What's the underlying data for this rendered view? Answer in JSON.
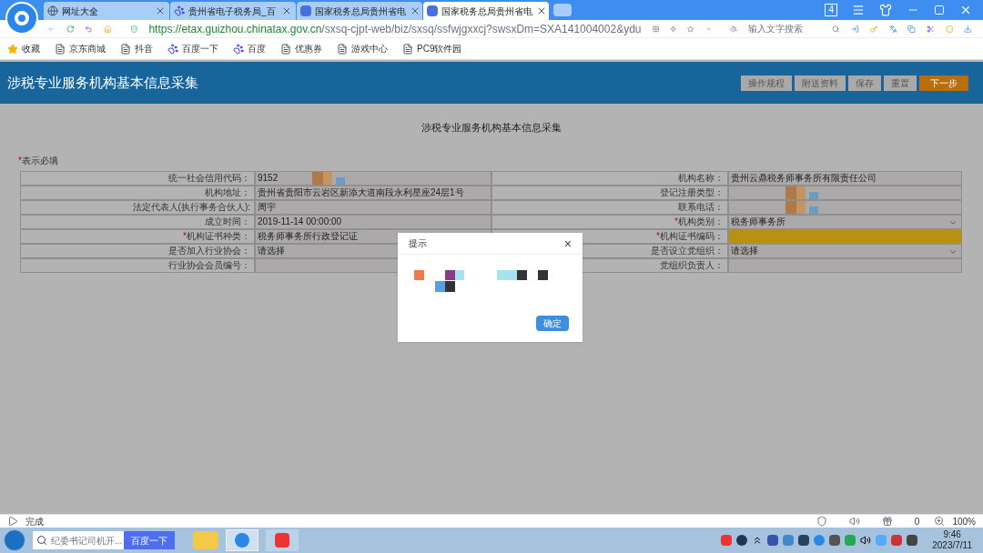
{
  "browser": {
    "tabs": [
      {
        "label": "网址大全",
        "selected": false,
        "kind": "globe"
      },
      {
        "label": "贵州省电子税务局_百",
        "selected": false,
        "kind": "paw"
      },
      {
        "label": "国家税务总局贵州省电",
        "selected": false,
        "kind": "site"
      },
      {
        "label": "国家税务总局贵州省电",
        "selected": true,
        "kind": "site"
      }
    ],
    "tab_count": "4",
    "url_host": "https://etax.guizhou.chinatax.gov.cn",
    "url_path": "/sxsq-cjpt-web/biz/sxsq/ssfwjgxxcj?swsxDm=SXA141004002&ydu",
    "search_placeholder": "输入文字搜索",
    "bookmarks": [
      {
        "label": "收藏",
        "kind": "star"
      },
      {
        "label": "京东商城",
        "kind": "page"
      },
      {
        "label": "抖音",
        "kind": "page"
      },
      {
        "label": "百度一下",
        "kind": "paw"
      },
      {
        "label": "百度",
        "kind": "paw"
      },
      {
        "label": "优惠券",
        "kind": "page"
      },
      {
        "label": "游戏中心",
        "kind": "page"
      },
      {
        "label": "PC9软件园",
        "kind": "page"
      }
    ]
  },
  "header": {
    "title": "涉税专业服务机构基本信息采集",
    "buttons": [
      {
        "label": "操作规程",
        "primary": false
      },
      {
        "label": "附送资料",
        "primary": false
      },
      {
        "label": "保存",
        "primary": false
      },
      {
        "label": "重置",
        "primary": false
      },
      {
        "label": "下一步",
        "primary": true
      }
    ]
  },
  "form": {
    "title": "涉税专业服务机构基本信息采集",
    "required_mark": "*",
    "required_note": "表示必填",
    "rows": [
      {
        "left": {
          "label": "统一社会信用代码：",
          "value": "9152",
          "required": false,
          "redacted": true
        },
        "right": {
          "label": "机构名称：",
          "value": "贵州云鼎税务师事务所有限责任公司",
          "required": false,
          "kind": "text",
          "highlighted": false,
          "redacted": false
        }
      },
      {
        "left": {
          "label": "机构地址：",
          "value": "贵州省贵阳市云岩区新添大道南段永利星座24层1号",
          "required": false,
          "redacted": false
        },
        "right": {
          "label": "登记注册类型：",
          "required": false,
          "kind": "text",
          "highlighted": false,
          "redacted": true
        }
      },
      {
        "left": {
          "label": "法定代表人(执行事务合伙人):",
          "value": "周宇",
          "required": false,
          "redacted": false
        },
        "right": {
          "label": "联系电话：",
          "required": false,
          "kind": "text",
          "highlighted": false,
          "redacted": true
        }
      },
      {
        "left": {
          "label": "成立时间：",
          "value": "2019-11-14 00:00:00",
          "required": false,
          "redacted": false
        },
        "right": {
          "label": "机构类别：",
          "value": "税务师事务所",
          "required": true,
          "kind": "select",
          "highlighted": false,
          "redacted": false
        }
      },
      {
        "left": {
          "label": "机构证书种类：",
          "value": "税务师事务所行政登记证",
          "required": true,
          "redacted": false
        },
        "right": {
          "label": "机构证书编码：",
          "required": true,
          "kind": "text",
          "highlighted": true,
          "redacted": false
        }
      },
      {
        "left": {
          "label": "是否加入行业协会：",
          "value": "请选择",
          "required": false,
          "redacted": false
        },
        "right": {
          "label": "是否设立党组织：",
          "value": "请选择",
          "required": false,
          "kind": "select",
          "highlighted": false,
          "redacted": false
        }
      },
      {
        "left": {
          "label": "行业协会会员编号：",
          "required": false,
          "redacted": false
        },
        "right": {
          "label": "党组织负责人：",
          "required": false,
          "kind": "text",
          "highlighted": false,
          "redacted": false
        }
      }
    ]
  },
  "dialog": {
    "title": "提示",
    "close": "×",
    "ok": "确定"
  },
  "status_bar": {
    "text": "完成",
    "ad_count": "0",
    "zoom": "100%"
  },
  "taskbar": {
    "search_placeholder": "纪委书记司机开...",
    "search_button": "百度一下",
    "time": "9:46",
    "date": "2023/7/11"
  }
}
